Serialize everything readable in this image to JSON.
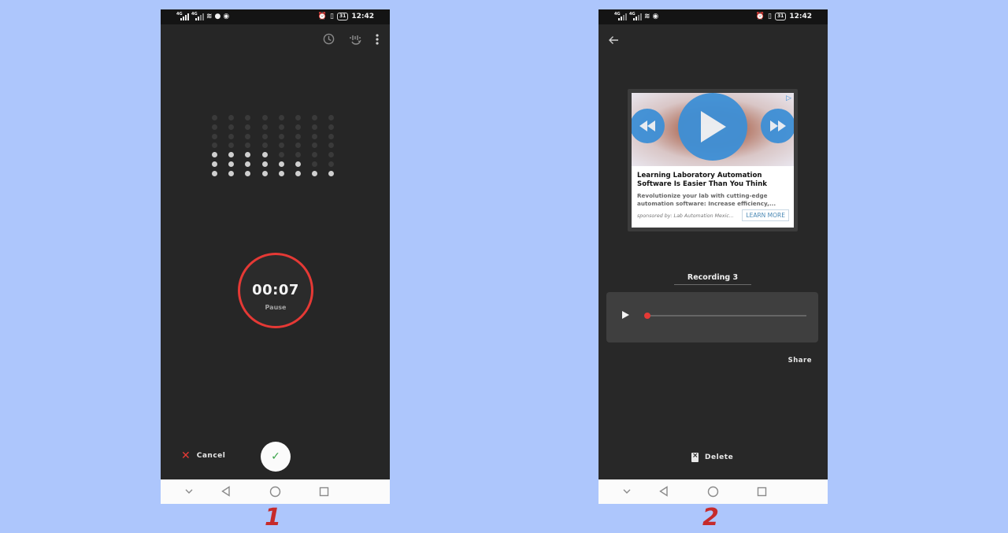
{
  "screens": [
    {
      "label": "1",
      "status_bar": {
        "time": "12:42",
        "battery": "31",
        "left_icons": [
          "signal-4g",
          "signal-4g",
          "wifi",
          "data-saver",
          "headset"
        ],
        "right_icons": [
          "alarm",
          "vibrate",
          "battery"
        ]
      },
      "toolbar": {
        "icons": [
          "history-icon",
          "voice-change-icon",
          "more-menu-icon"
        ]
      },
      "level_meter": {
        "columns": 8,
        "rows": 7,
        "lit_per_column": [
          3,
          3,
          3,
          3,
          2,
          2,
          1,
          1
        ]
      },
      "timer": {
        "time": "00:07",
        "action": "Pause"
      },
      "cancel_label": "Cancel",
      "confirm_icon": "check-icon",
      "colors": {
        "accent": "#e53935",
        "confirm": "#3aa44a",
        "background": "#262626"
      }
    },
    {
      "label": "2",
      "status_bar": {
        "time": "12:42",
        "battery": "31",
        "left_icons": [
          "signal-4g",
          "signal-4g",
          "wifi",
          "headset"
        ],
        "right_icons": [
          "alarm",
          "vibrate",
          "battery"
        ]
      },
      "ad": {
        "title": "Learning Laboratory Automation Software Is Easier Than You Think",
        "description": "Revolutionize your lab with cutting-edge automation software: Increase efficiency,...",
        "sponsor": "sponsored by: Lab Automation Mexic...",
        "cta": "LEARN MORE"
      },
      "recording": {
        "title": "Recording 3",
        "progress": 0
      },
      "share_label": "Share",
      "delete_label": "Delete",
      "colors": {
        "accent": "#e53935",
        "player_bg": "#3f3f3f"
      }
    }
  ],
  "nav_bar": {
    "buttons": [
      "hide-keyboard",
      "back",
      "home",
      "recents"
    ]
  }
}
